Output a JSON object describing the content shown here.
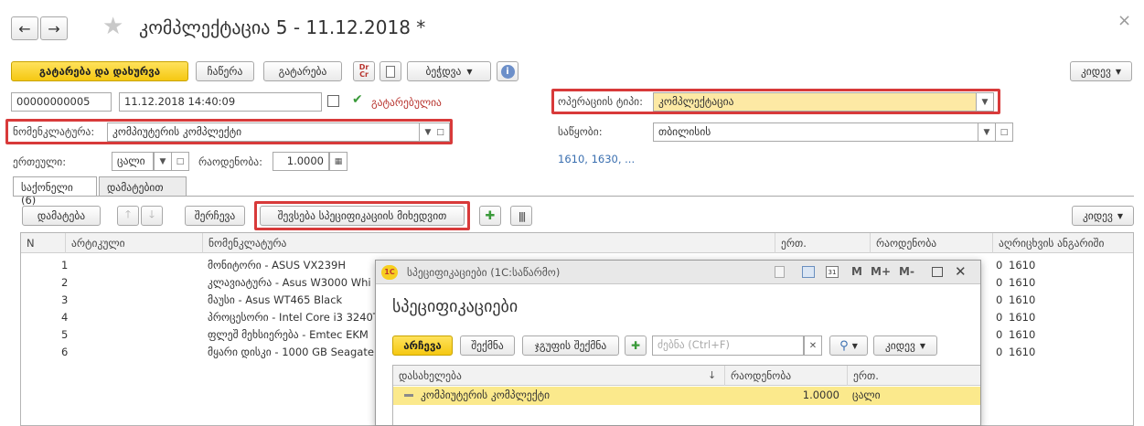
{
  "window": {
    "title": "კომპლექტაცია 5 - 11.12.2018 *",
    "close": "×"
  },
  "toolbar": {
    "post_close": "გატარება და დახურვა",
    "save": "ჩაწერა",
    "post": "გატარება",
    "drcr": "Dr Cr",
    "create_based": "ბეჭდვა",
    "more": "კიდევ"
  },
  "header": {
    "number": "00000000005",
    "date": "11.12.2018 14:40:09",
    "status": "გატარებულია",
    "operation_label": "ოპერაციის ტიპი:",
    "operation_value": "კომპლექტაცია",
    "nomenclature_label": "ნომენკლატურა:",
    "nomenclature_value": "კომპიუტერის კომპლექტი",
    "warehouse_label": "საწყობი:",
    "warehouse_value": "თბილისის",
    "unit_label": "ერთეული:",
    "unit_value": "ცალი",
    "quantity_label": "რაოდენობა:",
    "quantity_value": "1.0000",
    "accounts_link": "1610, 1630, ..."
  },
  "tabs": [
    {
      "label": "საქონელი (6)",
      "active": true
    },
    {
      "label": "დამატებით",
      "active": false
    }
  ],
  "table_toolbar": {
    "add": "დამატება",
    "select": "შერჩევა",
    "fill_by_spec": "შევსება სპეციფიკაციის მიხედვით",
    "more": "კიდევ"
  },
  "table": {
    "columns": {
      "n": "N",
      "article": "არტიკული",
      "nomenclature": "ნომენკლატურა",
      "unit": "ერთ.",
      "quantity": "რაოდენობა",
      "account": "აღრიცხვის ანგარიში"
    },
    "rows": [
      {
        "n": "1",
        "name": "მონიტორი - ASUS VX239H",
        "tail": "0",
        "account": "1610"
      },
      {
        "n": "2",
        "name": "კლავიატურა - Asus W3000 Whi",
        "tail": "0",
        "account": "1610"
      },
      {
        "n": "3",
        "name": "მაუსი - Asus WT465 Black",
        "tail": "0",
        "account": "1610"
      },
      {
        "n": "4",
        "name": "პროცესორი - Intel Core i3 3240T",
        "tail": "0",
        "account": "1610"
      },
      {
        "n": "5",
        "name": "ფლეშ მეხსიერება - Emtec EKM",
        "tail": "0",
        "account": "1610"
      },
      {
        "n": "6",
        "name": "მყარი დისკი - 1000 GB Seagate",
        "tail": "0",
        "account": "1610"
      }
    ]
  },
  "popup": {
    "title": "სპეციფიკაციები (1С:საწარმო)",
    "heading": "სპეციფიკაციები",
    "select_btn": "არჩევა",
    "create_btn": "შექმნა",
    "create_group_btn": "ჯგუფის შექმნა",
    "search_placeholder": "ძებნა (Ctrl+F)",
    "more": "კიდევ",
    "m": "M",
    "mplus": "M+",
    "mminus": "M-",
    "columns": {
      "name": "დასახელება",
      "sort": "↓",
      "quantity": "რაოდენობა",
      "unit": "ერთ."
    },
    "rows": [
      {
        "name": "კომპიუტერის კომპლექტი",
        "quantity": "1.0000",
        "unit": "ცალი"
      }
    ]
  },
  "colors": {
    "accent_yellow": "#f7cf1f",
    "highlight_red": "#d83a3a",
    "selected_row": "#fbe98c"
  }
}
